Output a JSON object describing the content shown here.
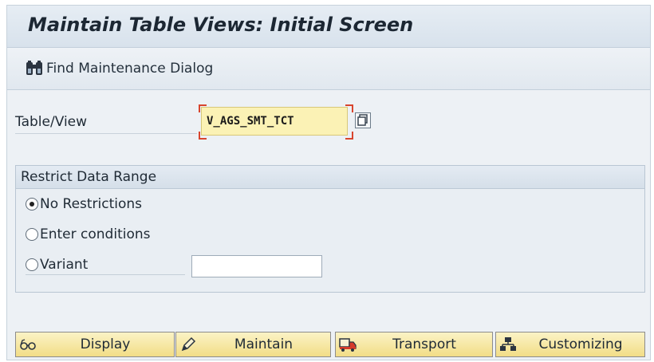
{
  "header": {
    "title": "Maintain Table Views: Initial Screen"
  },
  "toolbar": {
    "find_dialog_label": "Find Maintenance Dialog",
    "find_dialog_icon": "binoculars-icon"
  },
  "form": {
    "table_view_label": "Table/View",
    "table_view_value": "V_AGS_SMT_TCT",
    "table_view_required": true,
    "value_help_icon": "value-help-icon"
  },
  "restrict_group": {
    "title": "Restrict Data Range",
    "options": [
      {
        "label": "No Restrictions",
        "selected": true
      },
      {
        "label": "Enter conditions",
        "selected": false
      },
      {
        "label": "Variant",
        "selected": false
      }
    ],
    "variant_value": ""
  },
  "actions": [
    {
      "label": "Display",
      "icon": "glasses-icon"
    },
    {
      "label": "Maintain",
      "icon": "pencil-icon"
    },
    {
      "label": "Transport",
      "icon": "truck-icon"
    },
    {
      "label": "Customizing",
      "icon": "hierarchy-icon"
    }
  ],
  "colors": {
    "title_bar": "#dde6ef",
    "background": "#edf1f5",
    "required_input": "#fbf2b5",
    "required_marker": "#d8452e",
    "button_face": "#f5e49e"
  }
}
